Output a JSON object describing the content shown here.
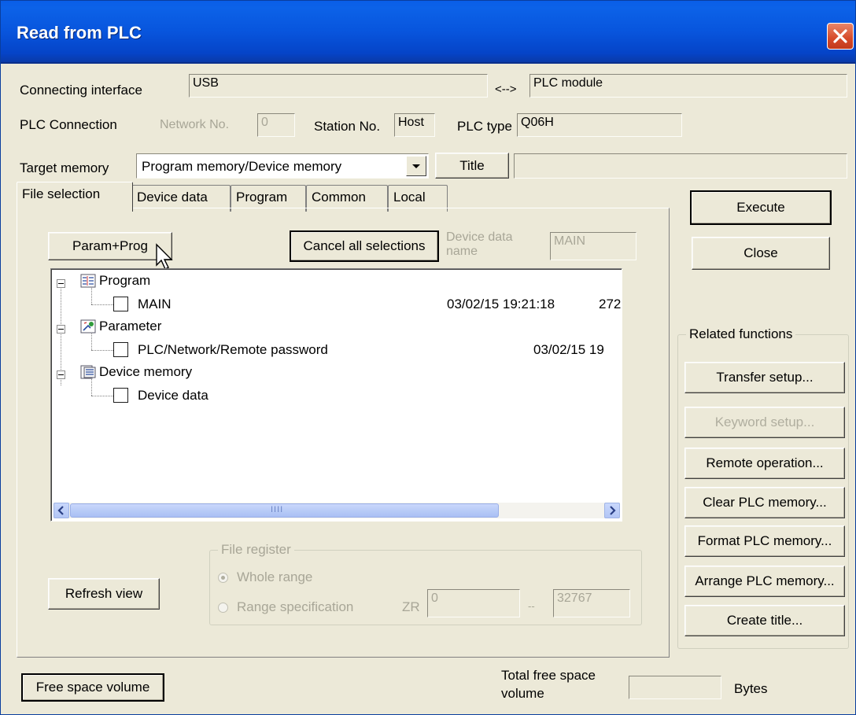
{
  "window": {
    "title": "Read from PLC"
  },
  "connection": {
    "interface_label": "Connecting interface",
    "interface_value": "USB",
    "arrow": "<-->",
    "module_value": "PLC module",
    "plc_connection_label": "PLC Connection",
    "network_no_label": "Network No.",
    "network_no_value": "0",
    "station_no_label": "Station No.",
    "station_no_value": "Host",
    "plc_type_label": "PLC type",
    "plc_type_value": "Q06H"
  },
  "target": {
    "label": "Target memory",
    "selected": "Program memory/Device memory",
    "title_button": "Title",
    "title_value": ""
  },
  "tabs": [
    {
      "label": "File selection",
      "active": true
    },
    {
      "label": "Device data"
    },
    {
      "label": "Program"
    },
    {
      "label": "Common"
    },
    {
      "label": "Local"
    }
  ],
  "file_selection": {
    "param_prog_button": "Param+Prog",
    "cancel_all_button": "Cancel all selections",
    "device_data_name_label": "Device data name",
    "device_data_name_value": "MAIN",
    "tree": [
      {
        "label": "Program",
        "icon": "program-icon",
        "children": [
          {
            "label": "MAIN",
            "date": "03/02/15 19:21:18",
            "size": "272"
          }
        ]
      },
      {
        "label": "Parameter",
        "icon": "parameter-icon",
        "children": [
          {
            "label": "PLC/Network/Remote password",
            "date": "03/02/15 19"
          }
        ]
      },
      {
        "label": "Device memory",
        "icon": "device-memory-icon",
        "children": [
          {
            "label": "Device data"
          }
        ]
      }
    ],
    "scroll_grip": "IIII",
    "refresh_button": "Refresh view",
    "file_register": {
      "caption": "File register",
      "whole_range": "Whole range",
      "range_spec": "Range specification",
      "zr_label": "ZR",
      "zr_from": "0",
      "zr_sep": "--",
      "zr_to": "32767"
    }
  },
  "buttons": {
    "execute": "Execute",
    "close": "Close"
  },
  "related": {
    "caption": "Related functions",
    "items": [
      {
        "label": "Transfer setup...",
        "enabled": true
      },
      {
        "label": "Keyword setup...",
        "enabled": false
      },
      {
        "label": "Remote operation...",
        "enabled": true
      },
      {
        "label": "Clear PLC memory...",
        "enabled": true
      },
      {
        "label": "Format PLC memory...",
        "enabled": true
      },
      {
        "label": "Arrange PLC memory...",
        "enabled": true
      },
      {
        "label": "Create title...",
        "enabled": true
      }
    ]
  },
  "footer": {
    "free_space_button": "Free space volume",
    "total_free_label_1": "Total free space",
    "total_free_label_2": "volume",
    "total_free_value": "",
    "bytes_label": "Bytes"
  },
  "colors": {
    "titlebar": "#0855dd",
    "dialog_bg": "#ece9d8",
    "close_button": "#d64a2a",
    "disabled_text": "#a8a697"
  }
}
